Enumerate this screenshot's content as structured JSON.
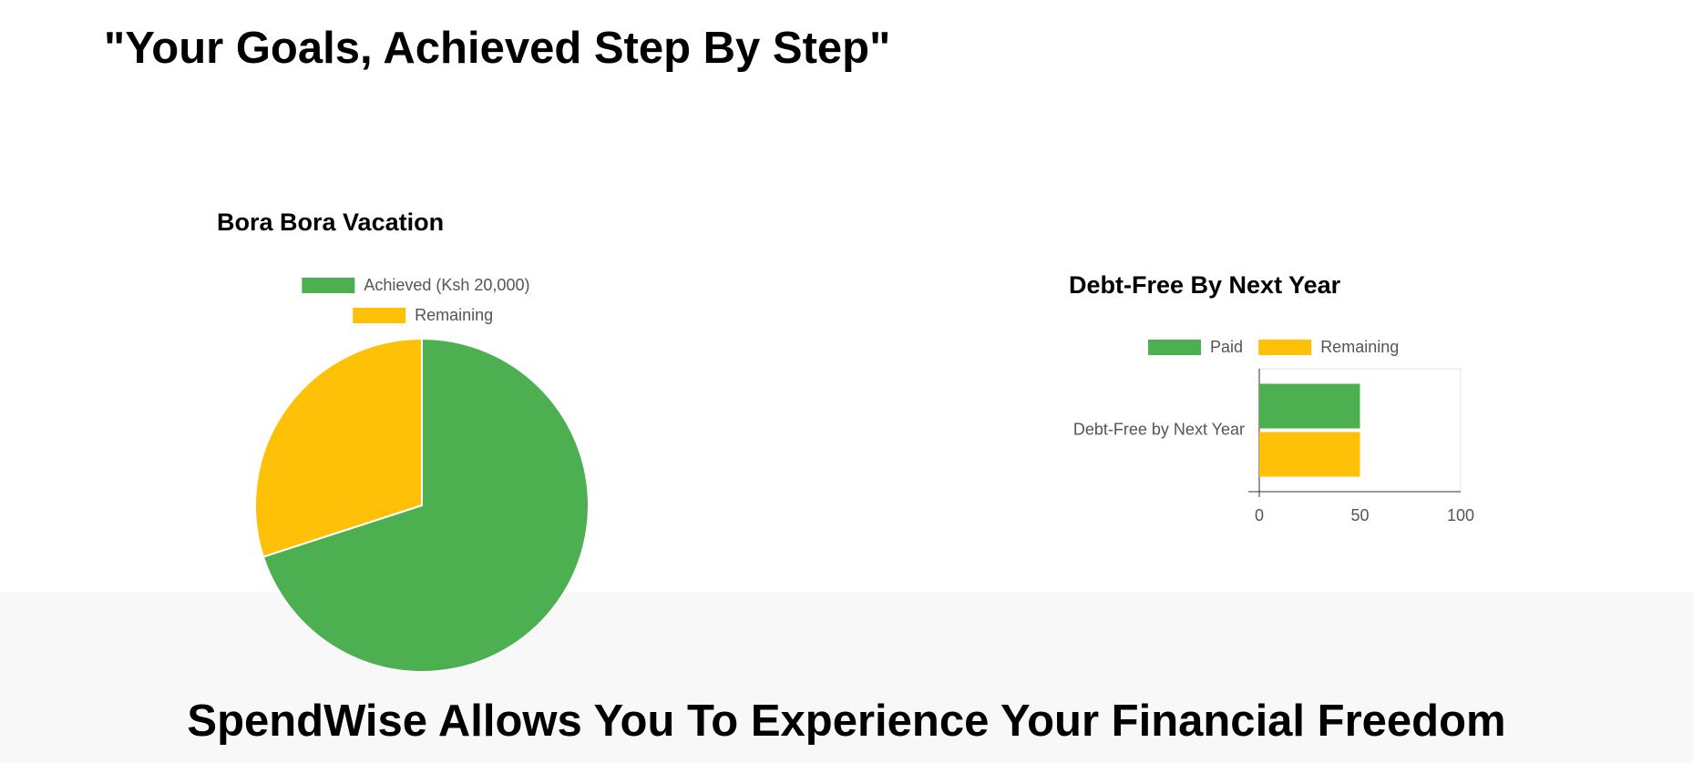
{
  "header": {
    "title": "\"Your Goals, Achieved Step By Step\""
  },
  "footer": {
    "title": "SpendWise Allows You To Experience Your Financial Freedom"
  },
  "colors": {
    "achieved": "#4caf50",
    "remaining": "#ffc107",
    "footer_bg": "#f8f8f8"
  },
  "chart_data": [
    {
      "type": "pie",
      "title": "Bora Bora Vacation",
      "legend_position": "top",
      "slices": [
        {
          "label": "Achieved (Ksh 20,000)",
          "value": 70,
          "color": "#4caf50"
        },
        {
          "label": "Remaining",
          "value": 30,
          "color": "#ffc107"
        }
      ]
    },
    {
      "type": "bar",
      "orientation": "horizontal",
      "title": "Debt-Free By Next Year",
      "legend_position": "top",
      "categories": [
        "Debt-Free by Next Year"
      ],
      "series": [
        {
          "name": "Paid",
          "values": [
            50
          ],
          "color": "#4caf50"
        },
        {
          "name": "Remaining",
          "values": [
            50
          ],
          "color": "#ffc107"
        }
      ],
      "xlim": [
        0,
        100
      ],
      "xticks": [
        "0",
        "50",
        "100"
      ],
      "grid": false
    }
  ]
}
